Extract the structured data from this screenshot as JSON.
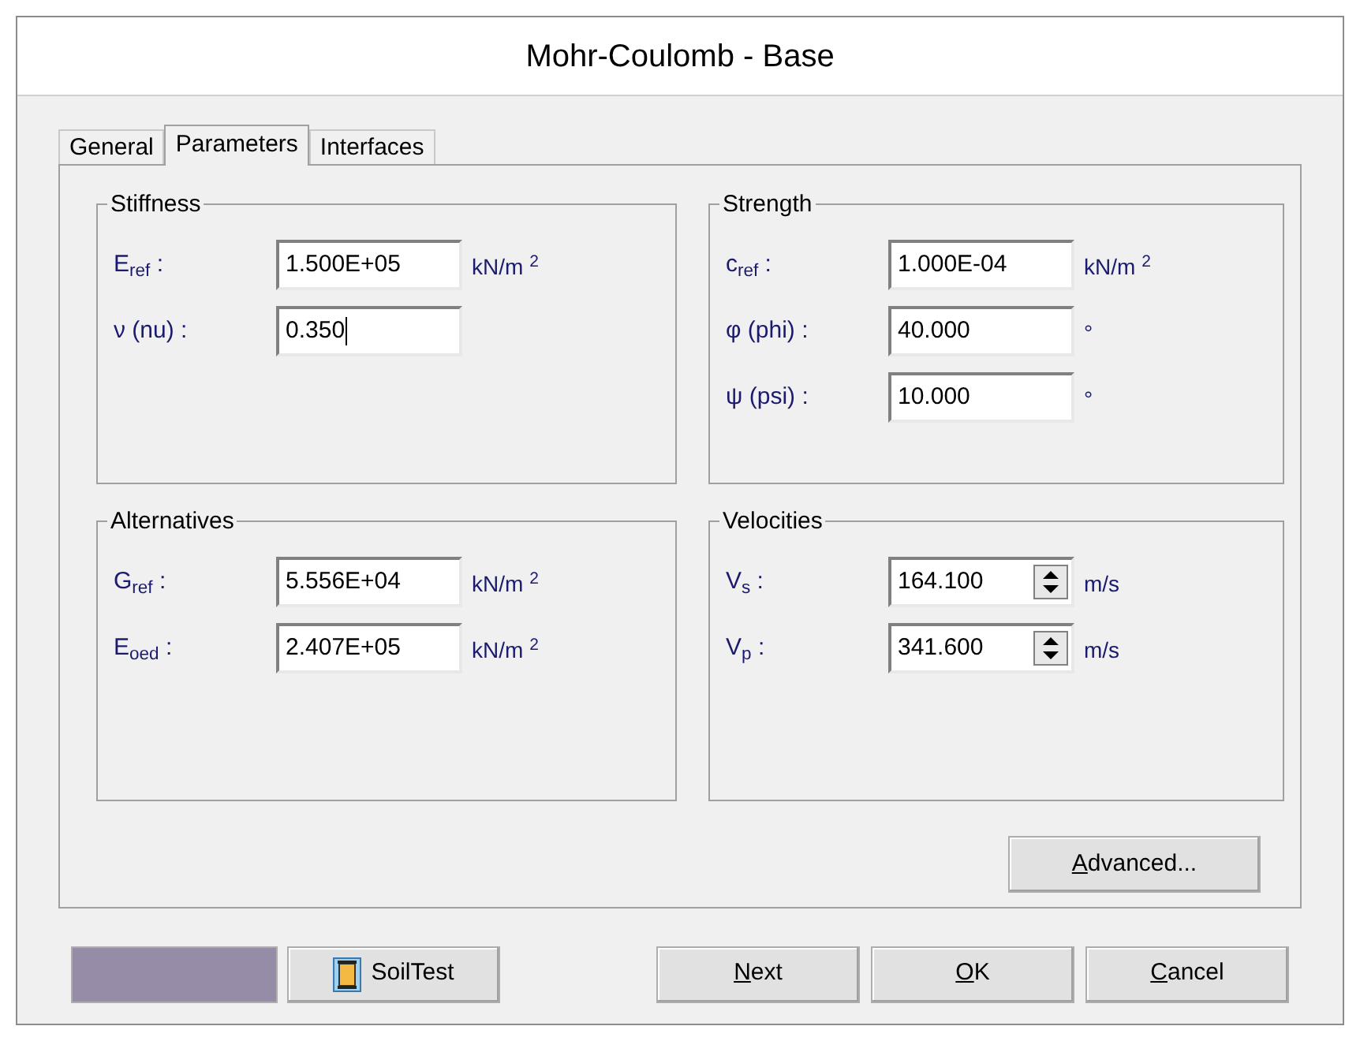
{
  "window": {
    "title": "Mohr-Coulomb - Base"
  },
  "tabs": [
    {
      "label": "General",
      "selected": false
    },
    {
      "label": "Parameters",
      "selected": true
    },
    {
      "label": "Interfaces",
      "selected": false
    }
  ],
  "groups": [
    {
      "title": "Stiffness",
      "fields": [
        {
          "kind": "text",
          "label": "E$_{ref}$ :",
          "value": "1.500E+05",
          "unit": "kN/m $^{2}$",
          "caret": false
        },
        {
          "kind": "text",
          "label": "ν (nu) :",
          "value": "0.350",
          "caret": true
        }
      ]
    },
    {
      "title": "Strength",
      "fields": [
        {
          "kind": "text",
          "label": "c$_{ref}$ :",
          "value": "1.000E-04",
          "unit": "kN/m $^{2}$",
          "caret": false
        },
        {
          "kind": "text",
          "label": "φ (phi) :",
          "value": "40.000",
          "unit": "°",
          "caret": false
        },
        {
          "kind": "text",
          "label": "ψ (psi) :",
          "value": "10.000",
          "unit": "°",
          "caret": false
        }
      ]
    },
    {
      "title": "Alternatives",
      "fields": [
        {
          "kind": "text",
          "label": "G$_{ref}$ :",
          "value": "5.556E+04",
          "unit": "kN/m $^{2}$",
          "caret": false
        },
        {
          "kind": "text",
          "label": "E$_{oed}$ :",
          "value": "2.407E+05",
          "unit": "kN/m $^{2}$",
          "caret": false
        }
      ]
    },
    {
      "title": "Velocities",
      "fields": [
        {
          "kind": "spin",
          "label": "V$_{s}$ :",
          "value": "164.100",
          "unit": "m/s",
          "caret": false
        },
        {
          "kind": "spin",
          "label": "V$_{p}$ :",
          "value": "341.600",
          "unit": "m/s",
          "caret": false
        }
      ]
    }
  ],
  "advanced_button": {
    "mnemonic": "A",
    "rest": "dvanced..."
  },
  "color_swatch": {
    "color": "#968ca8"
  },
  "soiltest_button": {
    "label": "SoilTest"
  },
  "dialog_buttons": [
    {
      "mnemonic": "N",
      "rest": "ext"
    },
    {
      "mnemonic": "O",
      "rest": "K"
    },
    {
      "mnemonic": "C",
      "rest": "ancel"
    }
  ]
}
